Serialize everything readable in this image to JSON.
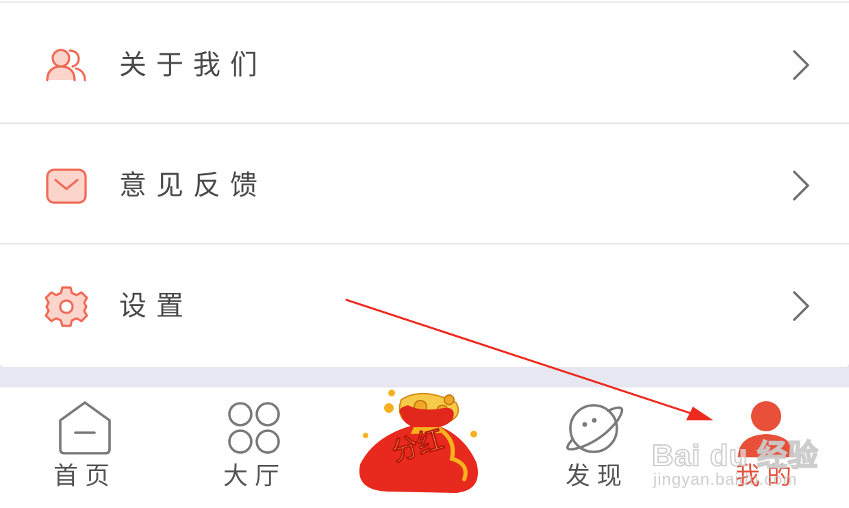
{
  "menu": {
    "items": [
      {
        "label": "关于我们",
        "icon": "users-icon"
      },
      {
        "label": "意见反馈",
        "icon": "mail-icon"
      },
      {
        "label": "设置",
        "icon": "gear-icon"
      }
    ]
  },
  "tabbar": {
    "tabs": [
      {
        "label": "首页",
        "icon": "home-icon",
        "active": false
      },
      {
        "label": "大厅",
        "icon": "grid-icon",
        "active": false
      },
      {
        "label": "分红",
        "icon": "money-bag-icon",
        "active": false
      },
      {
        "label": "发现",
        "icon": "planet-icon",
        "active": false
      },
      {
        "label": "我的",
        "icon": "person-icon",
        "active": true
      }
    ]
  },
  "watermark": {
    "brand": "Bai du 经验",
    "url": "jingyan.baidu.com"
  },
  "colors": {
    "accent": "#e8503a",
    "icon_fill": "#fbd4cc",
    "annotation": "#ee2a1f",
    "text": "#4a4a4a",
    "inactive_icon": "#7a7a7a",
    "band": "#e7e7f1"
  }
}
